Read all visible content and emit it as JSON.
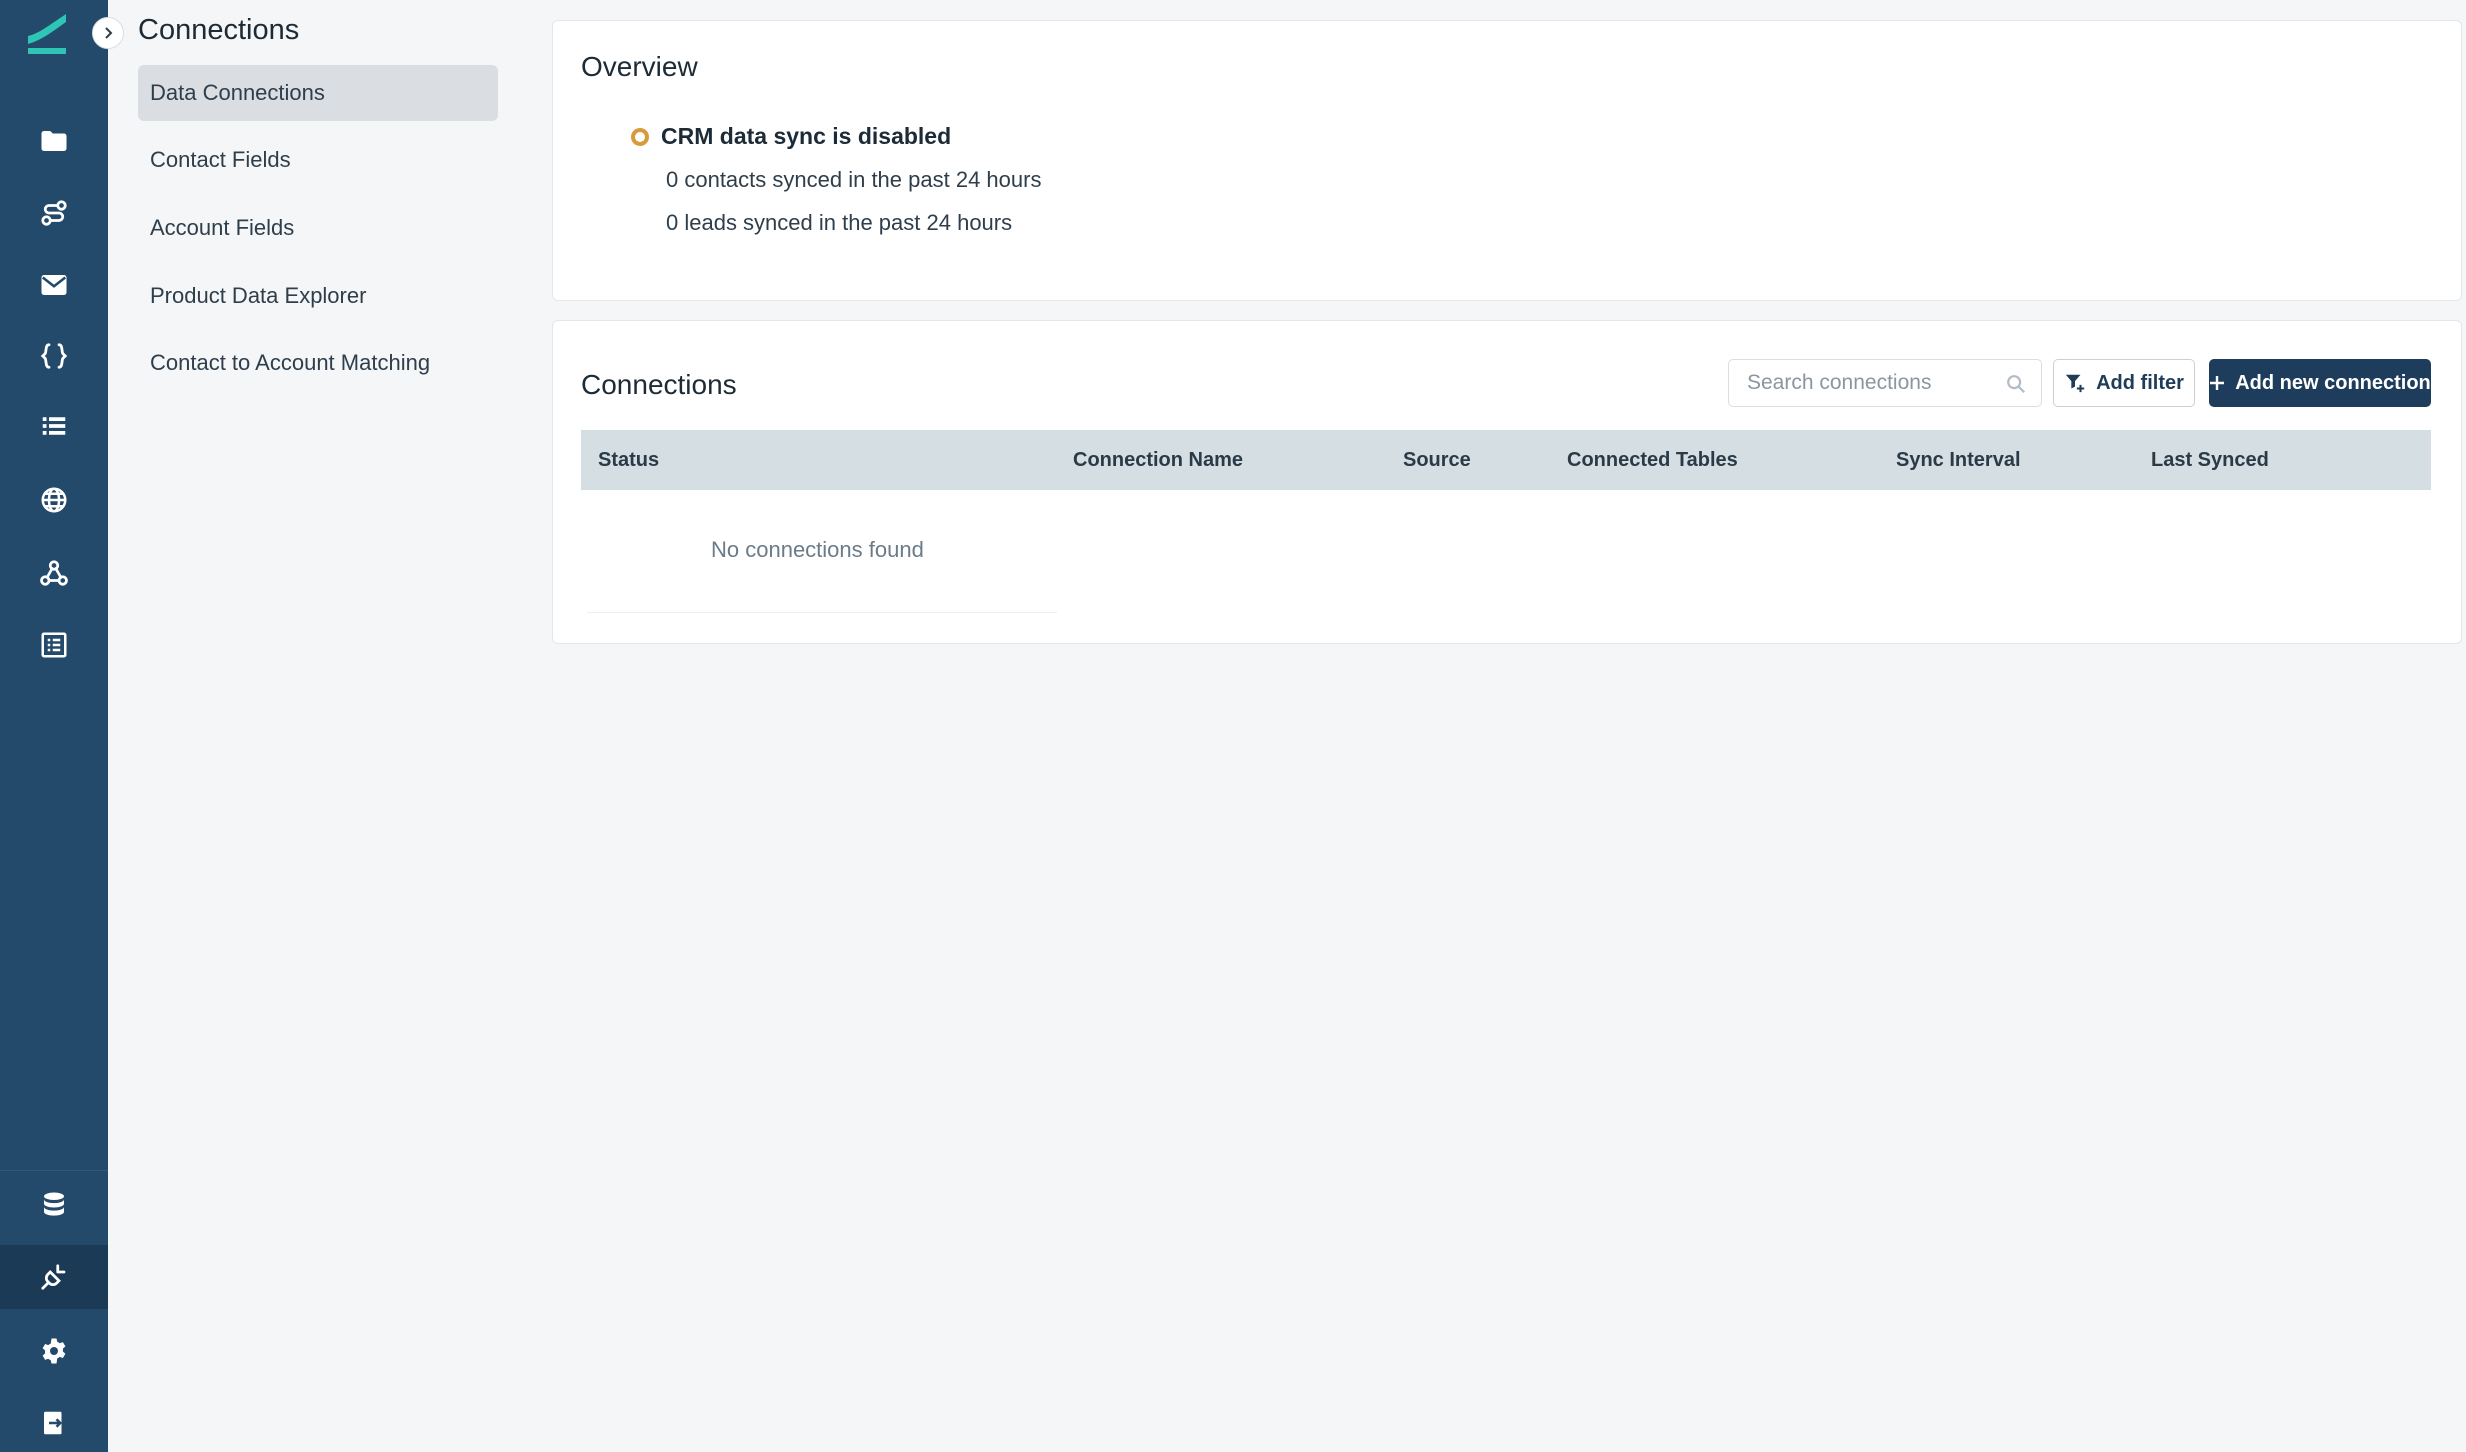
{
  "rail": {
    "items": [
      {
        "icon": "folder-icon"
      },
      {
        "icon": "route-icon"
      },
      {
        "icon": "mail-icon"
      },
      {
        "icon": "code-braces-icon"
      },
      {
        "icon": "list-icon"
      },
      {
        "icon": "globe-icon"
      },
      {
        "icon": "webhook-icon"
      },
      {
        "icon": "table-list-icon"
      }
    ],
    "bottom_items": [
      {
        "icon": "database-icon"
      },
      {
        "icon": "plug-icon",
        "active": true
      },
      {
        "icon": "gear-icon"
      },
      {
        "icon": "logout-icon"
      }
    ],
    "brand_color": "#2ec4b6",
    "background": "#244a6b"
  },
  "subnav": {
    "title": "Connections",
    "items": [
      {
        "label": "Data Connections",
        "active": true
      },
      {
        "label": "Contact Fields"
      },
      {
        "label": "Account Fields"
      },
      {
        "label": "Product Data Explorer"
      },
      {
        "label": "Contact to Account Matching"
      }
    ]
  },
  "overview": {
    "title": "Overview",
    "status": "CRM data sync is disabled",
    "status_color": "#d89a3c",
    "stats": [
      "0 contacts synced in the past 24 hours",
      "0 leads synced in the past 24 hours"
    ]
  },
  "connections": {
    "title": "Connections",
    "search_placeholder": "Search connections",
    "filter_label": "Add filter",
    "add_label": "Add new connection",
    "columns": [
      "Status",
      "Connection Name",
      "Source",
      "Connected Tables",
      "Sync Interval",
      "Last Synced"
    ],
    "empty_text": "No connections found"
  }
}
